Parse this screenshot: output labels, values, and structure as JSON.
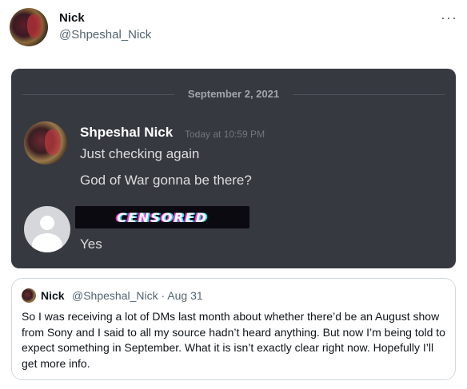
{
  "tweet": {
    "display_name": "Nick",
    "handle": "@Shpeshal_Nick",
    "more_label": "···"
  },
  "discord": {
    "date": "September 2, 2021",
    "messages": [
      {
        "author": "Shpeshal Nick",
        "timestamp": "Today at 10:59 PM",
        "lines": [
          "Just checking again",
          "God of War gonna be there?"
        ]
      },
      {
        "author_redacted": "CENSORED",
        "lines": [
          "Yes"
        ]
      }
    ]
  },
  "quote": {
    "name": "Nick",
    "meta": "@Shpeshal_Nick · Aug 31",
    "text": "So I was receiving a lot of DMs last month about whether there’d be an August show from Sony and I said to all my source hadn’t heard anything. But now I’m being told to expect something in September. What it is isn’t exactly clear right now. Hopefully I’ll get more info."
  }
}
